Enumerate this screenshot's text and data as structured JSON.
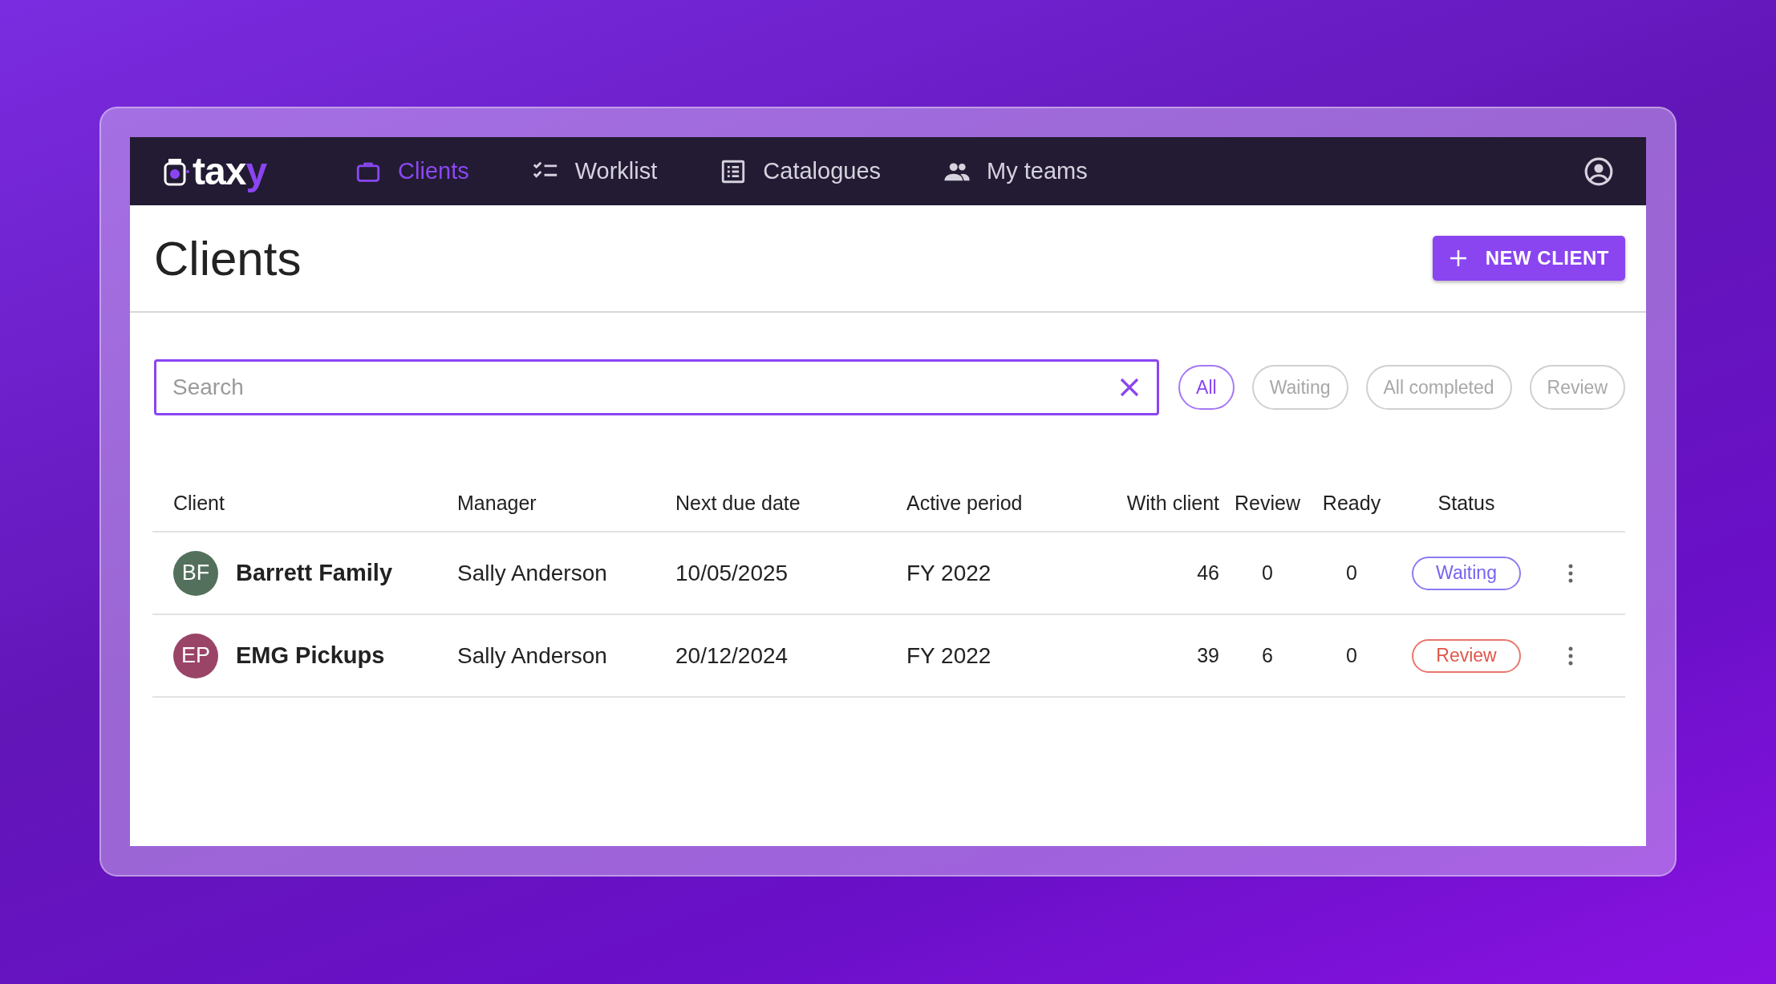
{
  "logo": {
    "text": "tax",
    "accent": "y"
  },
  "nav": [
    {
      "label": "Clients",
      "kind": "briefcase",
      "selected": true
    },
    {
      "label": "Worklist",
      "kind": "checklist",
      "selected": false
    },
    {
      "label": "Catalogues",
      "kind": "list",
      "selected": false
    },
    {
      "label": "My teams",
      "kind": "people",
      "selected": false
    }
  ],
  "page_title": "Clients",
  "new_button": {
    "label": "NEW CLIENT"
  },
  "search": {
    "placeholder": "Search"
  },
  "filters": [
    {
      "label": "All",
      "selected": true
    },
    {
      "label": "Waiting",
      "selected": false
    },
    {
      "label": "All completed",
      "selected": false
    },
    {
      "label": "Review",
      "selected": false
    }
  ],
  "table": {
    "columns": [
      "Client",
      "Manager",
      "Next due date",
      "Active period",
      "With client",
      "Review",
      "Ready",
      "Status"
    ],
    "rows": [
      {
        "initials": "BF",
        "color": "#52705c",
        "client": "Barrett Family",
        "manager": "Sally Anderson",
        "next_due": "10/05/2025",
        "period": "FY 2022",
        "with_client": "46",
        "review": "0",
        "ready": "0",
        "status": {
          "label": "Waiting",
          "kind": "waiting"
        }
      },
      {
        "initials": "EP",
        "color": "#9a4468",
        "client": "EMG Pickups",
        "manager": "Sally Anderson",
        "next_due": "20/12/2024",
        "period": "FY 2022",
        "with_client": "39",
        "review": "6",
        "ready": "0",
        "status": {
          "label": "Review",
          "kind": "review"
        }
      }
    ]
  }
}
